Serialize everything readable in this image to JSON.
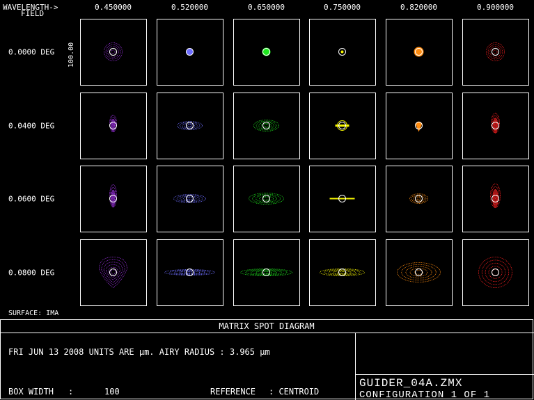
{
  "header": {
    "wavelength_label": "WAVELENGTH->",
    "field_label": "FIELD",
    "wavelengths": [
      "0.450000",
      "0.520000",
      "0.650000",
      "0.750000",
      "0.820000",
      "0.900000"
    ]
  },
  "fields": [
    "0.0000 DEG",
    "0.0400 DEG",
    "0.0600 DEG",
    "0.0800 DEG"
  ],
  "scale_label": "100.00",
  "surface_label": "SURFACE: IMA",
  "title": "MATRIX SPOT DIAGRAM",
  "info_line": "FRI JUN 13 2008  UNITS ARE µm.  AIRY RADIUS : 3.965 µm",
  "box_width_label": "BOX WIDTH",
  "box_width_sep": ":",
  "box_width_value": "100",
  "reference_label": "REFERENCE",
  "reference_sep": ": CENTROID",
  "file_name": "GUIDER_04A.ZMX",
  "configuration": "CONFIGURATION 1 OF 1",
  "colors": {
    "wl": [
      "#9b30e0",
      "#6d6dff",
      "#1ee81e",
      "#f5f500",
      "#ff8c10",
      "#ff2020"
    ],
    "frame": "#ffffff",
    "airy": "#ffffff"
  },
  "spots": [
    [
      {
        "shape": "ring",
        "rx": 13,
        "ry": 13
      },
      {
        "shape": "dot",
        "rx": 5,
        "ry": 5
      },
      {
        "shape": "dot",
        "rx": 6,
        "ry": 6
      },
      {
        "shape": "dot",
        "rx": 2,
        "ry": 2
      },
      {
        "shape": "dot",
        "rx": 7,
        "ry": 7
      },
      {
        "shape": "ring",
        "rx": 13,
        "ry": 13
      }
    ],
    [
      {
        "shape": "vert",
        "rx": 5,
        "ry": 12
      },
      {
        "shape": "ring",
        "rx": 18,
        "ry": 6
      },
      {
        "shape": "ring",
        "rx": 18,
        "ry": 8
      },
      {
        "shape": "bar",
        "rx": 10,
        "ry": 3
      },
      {
        "shape": "drop",
        "rx": 5,
        "ry": 9
      },
      {
        "shape": "vert",
        "rx": 6,
        "ry": 14
      }
    ],
    [
      {
        "shape": "vert",
        "rx": 5,
        "ry": 16
      },
      {
        "shape": "ring",
        "rx": 23,
        "ry": 6
      },
      {
        "shape": "ring",
        "rx": 25,
        "ry": 8
      },
      {
        "shape": "line",
        "rx": 18,
        "ry": 1
      },
      {
        "shape": "ring",
        "rx": 13,
        "ry": 7
      },
      {
        "shape": "vert",
        "rx": 7,
        "ry": 17
      }
    ],
    [
      {
        "shape": "pear",
        "rx": 20,
        "ry": 22
      },
      {
        "shape": "ring",
        "rx": 36,
        "ry": 4
      },
      {
        "shape": "ring",
        "rx": 37,
        "ry": 5
      },
      {
        "shape": "ring",
        "rx": 32,
        "ry": 5
      },
      {
        "shape": "ring",
        "rx": 31,
        "ry": 14
      },
      {
        "shape": "ring",
        "rx": 24,
        "ry": 22
      }
    ]
  ]
}
